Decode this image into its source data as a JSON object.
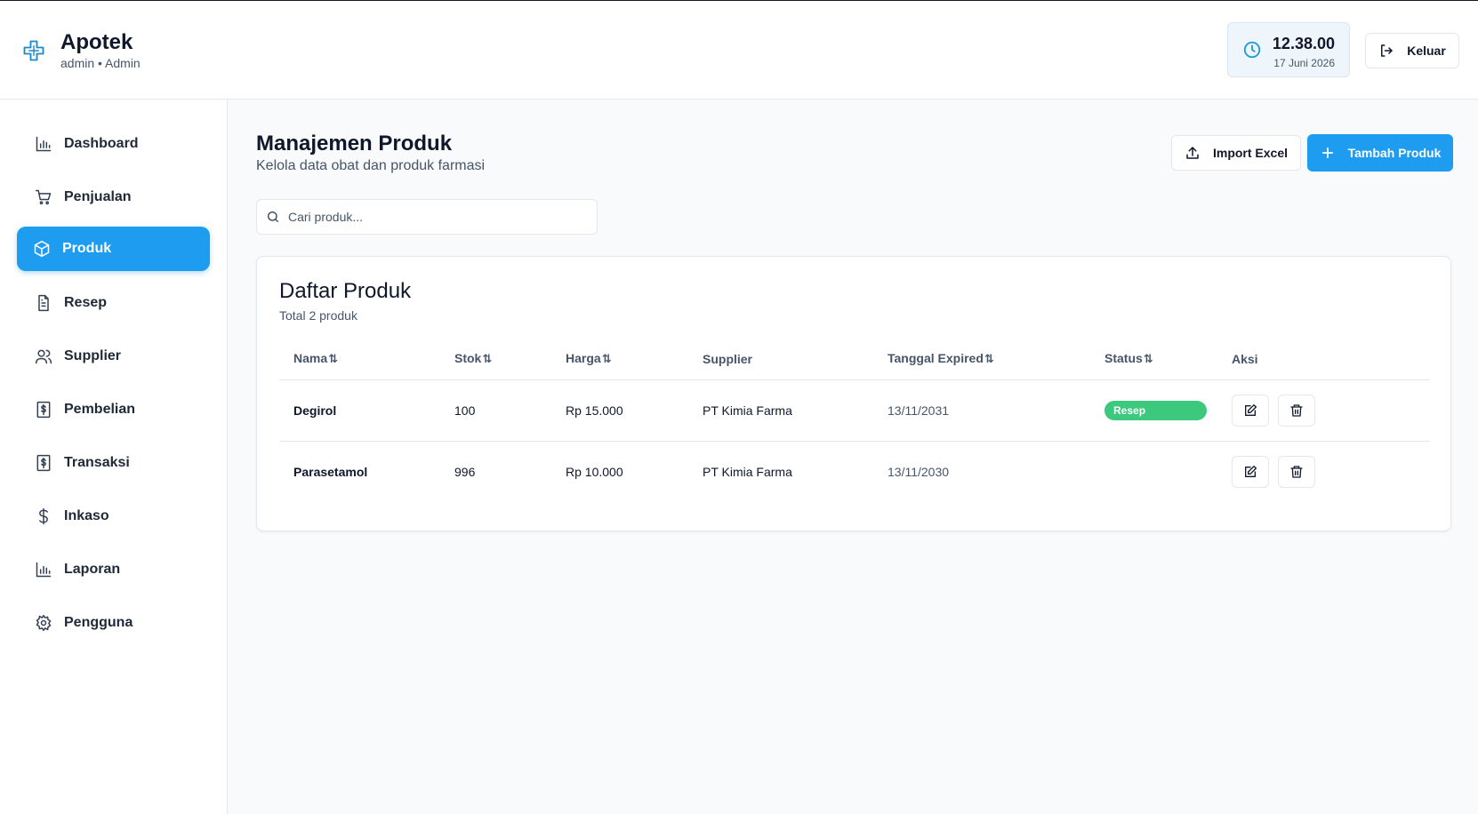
{
  "app": {
    "title": "Apotek",
    "user": "admin • Admin"
  },
  "clock": {
    "time": "12.38.00",
    "date": "17 Juni 2026"
  },
  "logout_label": "Keluar",
  "sidebar": {
    "items": [
      {
        "label": "Dashboard",
        "icon": "bar-chart-icon"
      },
      {
        "label": "Penjualan",
        "icon": "cart-icon"
      },
      {
        "label": "Produk",
        "icon": "package-icon",
        "active": true
      },
      {
        "label": "Resep",
        "icon": "file-text-icon"
      },
      {
        "label": "Supplier",
        "icon": "users-icon"
      },
      {
        "label": "Pembelian",
        "icon": "receipt-dollar-icon"
      },
      {
        "label": "Transaksi",
        "icon": "receipt-dollar-icon"
      },
      {
        "label": "Inkaso",
        "icon": "dollar-icon"
      },
      {
        "label": "Laporan",
        "icon": "bar-chart-icon"
      },
      {
        "label": "Pengguna",
        "icon": "gear-icon"
      }
    ]
  },
  "page": {
    "title": "Manajemen Produk",
    "subtitle": "Kelola data obat dan produk farmasi",
    "import_label": "Import Excel",
    "add_label": "Tambah Produk"
  },
  "search": {
    "placeholder": "Cari produk..."
  },
  "list": {
    "title": "Daftar Produk",
    "subtitle": "Total 2 produk",
    "columns": [
      "Nama",
      "Stok",
      "Harga",
      "Supplier",
      "Tanggal Expired",
      "Status",
      "Aksi"
    ],
    "sort_glyph": "⇅",
    "rows": [
      {
        "nama": "Degirol",
        "stok": "100",
        "harga": "Rp 15.000",
        "supplier": "PT Kimia Farma",
        "expired": "13/11/2031",
        "status": "Resep"
      },
      {
        "nama": "Parasetamol",
        "stok": "996",
        "harga": "Rp 10.000",
        "supplier": "PT Kimia Farma",
        "expired": "13/11/2030",
        "status": ""
      }
    ]
  },
  "colors": {
    "accent": "#1e9cf0",
    "badge": "#3cc97e"
  }
}
